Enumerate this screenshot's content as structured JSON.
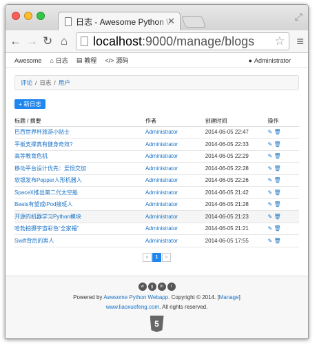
{
  "browser": {
    "tab_title": "日志 - Awesome Python Webapp",
    "url_host": "localhost",
    "url_rest": ":9000/manage/blogs"
  },
  "navbar": {
    "brand": "Awesome",
    "items": [
      {
        "label": "日志"
      },
      {
        "label": "教程"
      },
      {
        "label": "源码"
      }
    ],
    "user": "Administrator"
  },
  "breadcrumb": [
    {
      "label": "评论"
    },
    {
      "label": "日志"
    },
    {
      "label": "用户"
    }
  ],
  "new_button": "新日志",
  "table": {
    "headers": [
      "标题 / 摘要",
      "作者",
      "创建时间",
      "操作"
    ],
    "rows": [
      {
        "title": "巴西世界杯旅游小贴士",
        "author": "Administrator",
        "date": "2014-06-05 22:47"
      },
      {
        "title": "平板支撑真有健身奇效?",
        "author": "Administrator",
        "date": "2014-06-05 22:33"
      },
      {
        "title": "高等教育危机",
        "author": "Administrator",
        "date": "2014-06-05 22:29"
      },
      {
        "title": "移动平台设计优先：爱恨交加",
        "author": "Administrator",
        "date": "2014-06-05 22:28"
      },
      {
        "title": "软银发布Pepper人形机器人",
        "author": "Administrator",
        "date": "2014-06-05 22:26"
      },
      {
        "title": "SpaceX推出第二代太空船",
        "author": "Administrator",
        "date": "2014-06-05 21:42"
      },
      {
        "title": "Beats有望成iPod接班人",
        "author": "Administrator",
        "date": "2014-06-05 21:28"
      },
      {
        "title": "开源的机器学习Python模块",
        "author": "Administrator",
        "date": "2014-06-05 21:23"
      },
      {
        "title": "哈勃拍摄宇宙彩色“全家福”",
        "author": "Administrator",
        "date": "2014-06-05 21:21"
      },
      {
        "title": "Swift背后的男人",
        "author": "Administrator",
        "date": "2014-06-05 17:55"
      }
    ]
  },
  "pagination": {
    "prev": "«",
    "current": "1",
    "next": "»"
  },
  "footer": {
    "powered_prefix": "Powered by",
    "powered_link": "Awesome Python Webapp",
    "copyright": ". Copyright © 2014. [",
    "manage": "Manage",
    "close_bracket": "]",
    "site": "www.liaoxuefeng.com",
    "rights": ". All rights reserved.",
    "html5_badge": "5"
  },
  "colors": {
    "accent": "#1e87f0",
    "link": "#1a73c7"
  }
}
